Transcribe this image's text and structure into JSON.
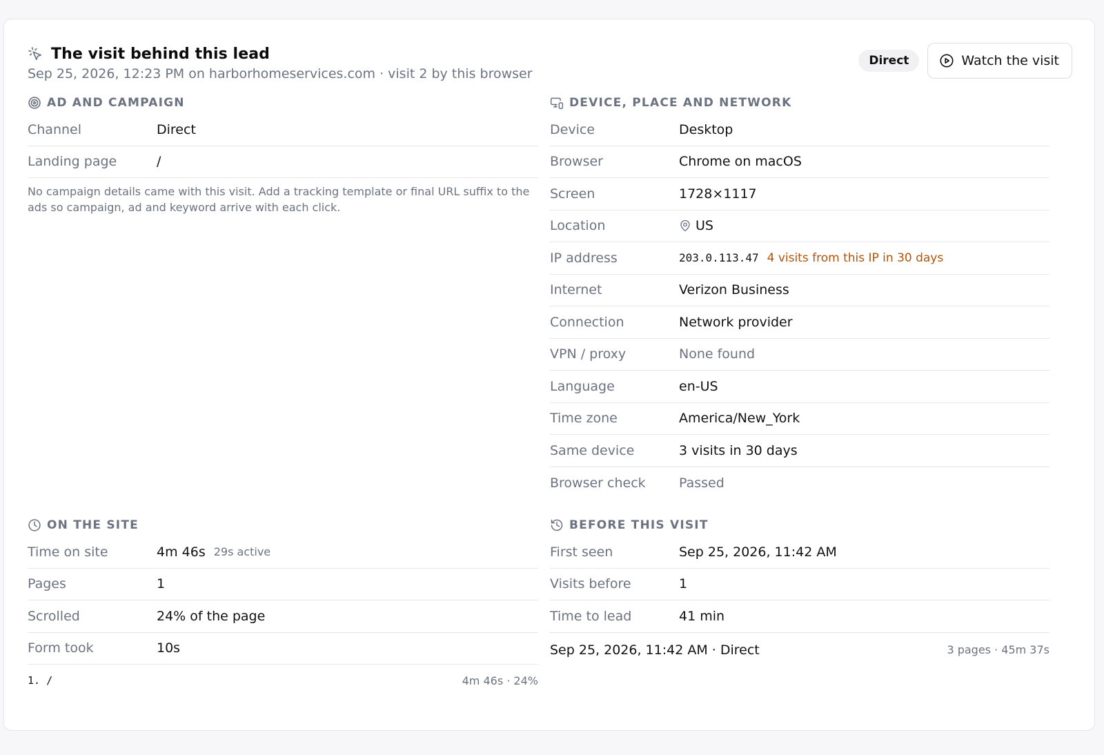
{
  "header": {
    "title": "The visit behind this lead",
    "subtitle": "Sep 25, 2026, 12:23 PM on harborhomeservices.com · visit 2 by this browser",
    "badge": "Direct",
    "watch_label": "Watch the visit"
  },
  "ad_campaign": {
    "title": "AD AND CAMPAIGN",
    "rows": [
      {
        "label": "Channel",
        "value": "Direct"
      },
      {
        "label": "Landing page",
        "value": "/"
      }
    ],
    "note": "No campaign details came with this visit. Add a tracking template or final URL suffix to the ads so campaign, ad and keyword arrive with each click."
  },
  "device": {
    "title": "DEVICE, PLACE AND NETWORK",
    "device": {
      "label": "Device",
      "value": "Desktop"
    },
    "browser": {
      "label": "Browser",
      "value": "Chrome on macOS"
    },
    "screen": {
      "label": "Screen",
      "value": "1728×1117"
    },
    "location": {
      "label": "Location",
      "value": "US"
    },
    "ip": {
      "label": "IP address",
      "value": "203.0.113.47",
      "note": "4 visits from this IP in 30 days"
    },
    "internet": {
      "label": "Internet",
      "value": "Verizon Business"
    },
    "connection": {
      "label": "Connection",
      "value": "Network provider"
    },
    "vpn": {
      "label": "VPN / proxy",
      "value": "None found"
    },
    "language": {
      "label": "Language",
      "value": "en-US"
    },
    "timezone": {
      "label": "Time zone",
      "value": "America/New_York"
    },
    "same_device": {
      "label": "Same device",
      "value": "3 visits in 30 days"
    },
    "browser_check": {
      "label": "Browser check",
      "value": "Passed"
    }
  },
  "on_site": {
    "title": "ON THE SITE",
    "time_on_site": {
      "label": "Time on site",
      "value": "4m 46s",
      "active": "29s active"
    },
    "pages": {
      "label": "Pages",
      "value": "1"
    },
    "scrolled": {
      "label": "Scrolled",
      "value": "24% of the page"
    },
    "form_took": {
      "label": "Form took",
      "value": "10s"
    },
    "page_list": [
      {
        "path": "1. /",
        "meta": "4m 46s · 24%"
      }
    ]
  },
  "before": {
    "title": "BEFORE THIS VISIT",
    "first_seen": {
      "label": "First seen",
      "value": "Sep 25, 2026, 11:42 AM"
    },
    "visits_before": {
      "label": "Visits before",
      "value": "1"
    },
    "time_to_lead": {
      "label": "Time to lead",
      "value": "41 min"
    },
    "prior_visit": {
      "summary": "Sep 25, 2026, 11:42 AM · Direct",
      "meta": "3 pages · 45m 37s"
    }
  }
}
